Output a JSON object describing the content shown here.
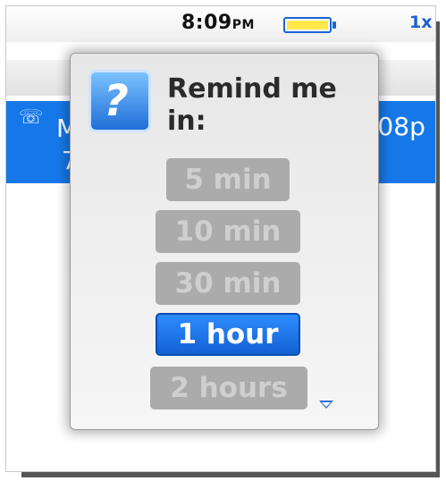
{
  "status_bar": {
    "time": "8:09",
    "ampm": "PM",
    "battery_level": 1.0,
    "battery_color": "#ffe84a",
    "network_label": "1x"
  },
  "list_row": {
    "icon": "missed-call-icon",
    "partial_name": "M",
    "partial_time": ":08p",
    "partial_second_line": "7",
    "highlight_color": "#1678e8"
  },
  "dialog": {
    "icon": "question-mark-icon",
    "title": "Remind me in:",
    "options": [
      {
        "label": "5 min",
        "selected": false
      },
      {
        "label": "10 min",
        "selected": false
      },
      {
        "label": "30 min",
        "selected": false
      },
      {
        "label": "1 hour",
        "selected": true
      },
      {
        "label": "2 hours",
        "selected": false
      }
    ],
    "more_below_icon": "scroll-down-icon"
  }
}
